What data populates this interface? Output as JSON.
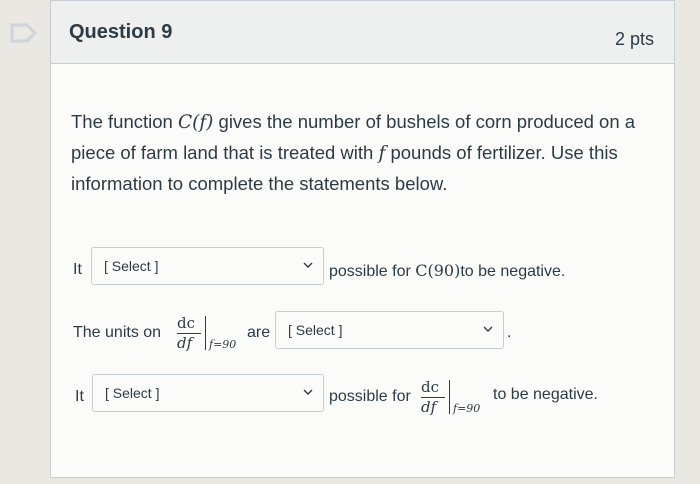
{
  "question": {
    "title": "Question 9",
    "points": "2 pts",
    "text_parts": {
      "p1": "The function ",
      "func": "C(f)",
      "p2": " gives the number of bushels of corn produced on a piece of farm land that is treated with ",
      "var": "f",
      "p3": " pounds of fertilizer. Use this information to complete the statements below."
    }
  },
  "rows": [
    {
      "prefix": "It",
      "select": "[ Select ]",
      "suffix": "possible for ",
      "math": "C(90)",
      "suffix2": "to be negative."
    },
    {
      "prefix": "The units on",
      "frac_num": "dc",
      "frac_den": "df",
      "frac_sub": "f=90",
      "middle": "are",
      "select": "[ Select ]",
      "suffix": "."
    },
    {
      "prefix": "It",
      "select": "[ Select ]",
      "suffix": "possible for",
      "frac_num": "dc",
      "frac_den": "df",
      "frac_sub": "f=90",
      "suffix2": "to be negative."
    }
  ],
  "colors": {
    "background": "#e9e8e3",
    "card": "#fbfbf9",
    "header": "#eef0ef",
    "text": "#2d3b45"
  },
  "icons": {
    "flag": "bookmark-flag-icon",
    "dropdown": "chevron-down-icon"
  }
}
